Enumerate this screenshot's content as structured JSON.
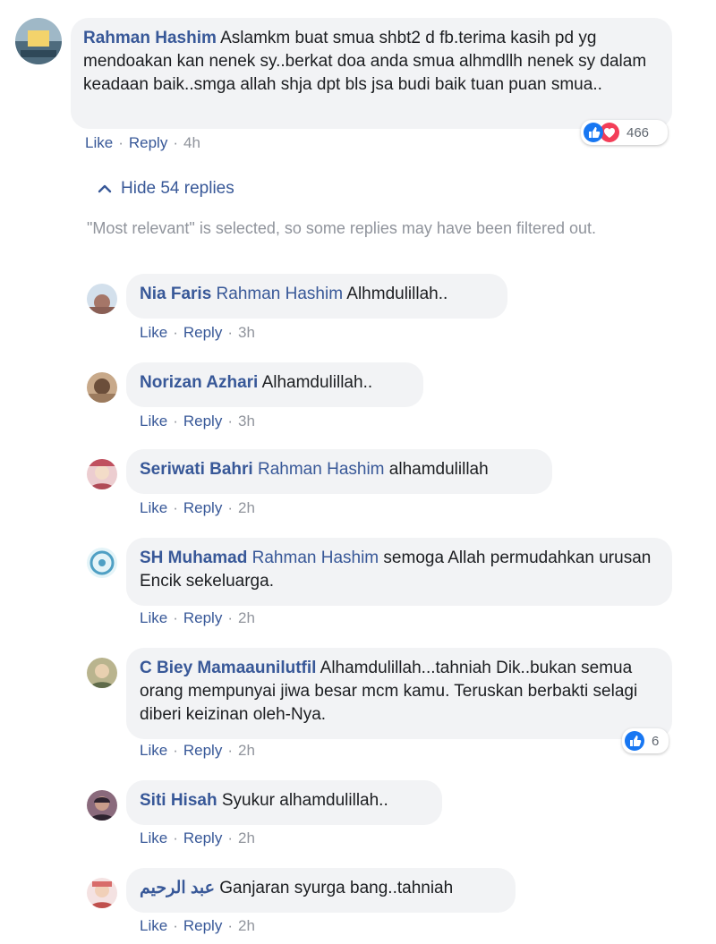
{
  "top_comment": {
    "author": "Rahman Hashim",
    "text": "Aslamkm buat smua shbt2 d fb.terima kasih pd yg mendoakan kan nenek sy..berkat doa anda smua alhmdllh nenek sy dalam keadaan baik..smga allah shja dpt bls jsa budi baik tuan puan smua..",
    "like": "Like",
    "reply": "Reply",
    "time": "4h",
    "reaction_count": "466",
    "avatar_colors": [
      "#8aa6b8",
      "#3d5a6e"
    ]
  },
  "replies_toggle": {
    "icon": "chevron-up-icon",
    "label": "Hide 54 replies"
  },
  "filter_note": "\"Most relevant\" is selected, so some replies may have been filtered out.",
  "replies": [
    {
      "author": "Nia Faris",
      "mention": "Rahman Hashim",
      "text": "Alhmdulillah..",
      "like": "Like",
      "reply": "Reply",
      "time": "3h",
      "avatar_colors": [
        "#c9d7e6",
        "#b07a6a"
      ]
    },
    {
      "author": "Norizan Azhari",
      "mention": "",
      "text": "Alhamdulillah..",
      "like": "Like",
      "reply": "Reply",
      "time": "3h",
      "avatar_colors": [
        "#c8a98a",
        "#6b4e3a"
      ]
    },
    {
      "author": "Seriwati Bahri",
      "mention": "Rahman Hashim",
      "text": "alhamdulillah",
      "like": "Like",
      "reply": "Reply",
      "time": "2h",
      "avatar_colors": [
        "#e8c5c8",
        "#b04a57"
      ]
    },
    {
      "author": "SH Muhamad",
      "mention": "Rahman Hashim",
      "text": "semoga Allah permudahkan urusan Encik sekeluarga.",
      "like": "Like",
      "reply": "Reply",
      "time": "2h",
      "avatar_colors": [
        "#d6eef5",
        "#4fa0c4"
      ]
    },
    {
      "author": "C Biey Mamaaunilutfil",
      "mention": "",
      "text": "Alhamdulillah...tahniah Dik..bukan semua orang mempunyai jiwa besar mcm kamu. Teruskan berbakti selagi diberi keizinan oleh-Nya.",
      "like": "Like",
      "reply": "Reply",
      "time": "2h",
      "reaction_count": "6",
      "avatar_colors": [
        "#b9b48e",
        "#5f6b4a"
      ]
    },
    {
      "author": "Siti Hisah",
      "mention": "",
      "text": "Syukur alhamdulillah..",
      "like": "Like",
      "reply": "Reply",
      "time": "2h",
      "avatar_colors": [
        "#8a6a7c",
        "#2e2430"
      ]
    },
    {
      "author": "عبد الرحيم",
      "mention": "",
      "text": "Ganjaran syurga bang..tahniah",
      "like": "Like",
      "reply": "Reply",
      "time": "2h",
      "avatar_colors": [
        "#f1d6d6",
        "#c0504d"
      ]
    }
  ],
  "colors": {
    "link": "#385898",
    "bubble": "#f2f3f5",
    "like_blue": "#1877f2",
    "love_red": "#f33e58",
    "muted": "#90949c"
  }
}
